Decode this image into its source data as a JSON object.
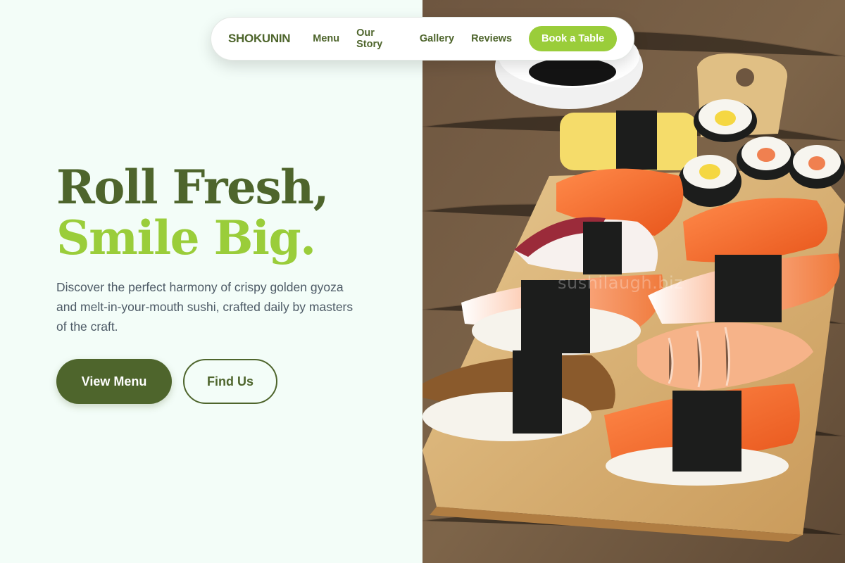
{
  "nav": {
    "brand": "SHOKUNIN",
    "links": [
      "Menu",
      "Our Story",
      "Gallery",
      "Reviews"
    ],
    "cta": "Book a Table"
  },
  "hero": {
    "headline_line1": "Roll Fresh,",
    "headline_line2": "Smile Big.",
    "subtitle": "Discover the perfect harmony of crispy golden gyoza and melt-in-your-mouth sushi, crafted daily by masters of the craft.",
    "primary_button": "View Menu",
    "secondary_button": "Find Us"
  },
  "image": {
    "watermark": "sushilaugh.biz"
  },
  "colors": {
    "brand_dark_green": "#4e652c",
    "accent_lime": "#9acd3a",
    "background_mint": "#f3fdf8",
    "body_text": "#4d5a66"
  }
}
